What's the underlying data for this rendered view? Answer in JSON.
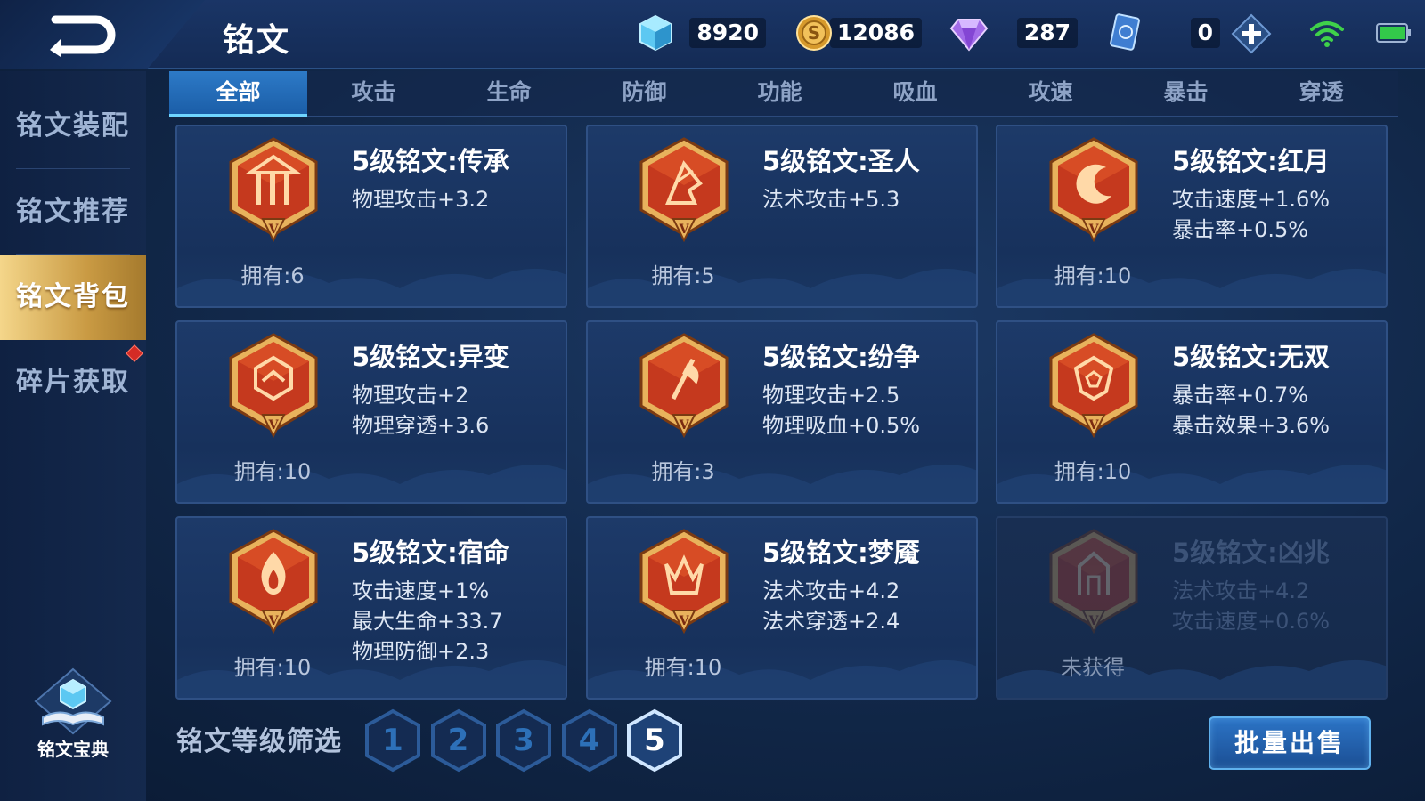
{
  "header": {
    "title": "铭文",
    "currencies": {
      "crystal": "8920",
      "coin": "12086",
      "diamond": "287",
      "card": "0"
    }
  },
  "sidebar": {
    "items": [
      {
        "label": "铭文装配"
      },
      {
        "label": "铭文推荐"
      },
      {
        "label": "铭文背包"
      },
      {
        "label": "碎片获取"
      }
    ],
    "active_index": 2,
    "codex_label": "铭文宝典"
  },
  "tabs": [
    "全部",
    "攻击",
    "生命",
    "防御",
    "功能",
    "吸血",
    "攻速",
    "暴击",
    "穿透"
  ],
  "active_tab": 0,
  "runes": [
    {
      "name": "5级铭文:传承",
      "stats": [
        "物理攻击+3.2"
      ],
      "owned": "拥有:6",
      "icon": "pillars-rune-icon",
      "locked": false
    },
    {
      "name": "5级铭文:圣人",
      "stats": [
        "法术攻击+5.3"
      ],
      "owned": "拥有:5",
      "icon": "crystal-rune-icon",
      "locked": false
    },
    {
      "name": "5级铭文:红月",
      "stats": [
        "攻击速度+1.6%",
        "暴击率+0.5%"
      ],
      "owned": "拥有:10",
      "icon": "crescent-moon-rune-icon",
      "locked": false
    },
    {
      "name": "5级铭文:异变",
      "stats": [
        "物理攻击+2",
        "物理穿透+3.6"
      ],
      "owned": "拥有:10",
      "icon": "hexagon-rune-icon",
      "locked": false
    },
    {
      "name": "5级铭文:纷争",
      "stats": [
        "物理攻击+2.5",
        "物理吸血+0.5%"
      ],
      "owned": "拥有:3",
      "icon": "axe-rune-icon",
      "locked": false
    },
    {
      "name": "5级铭文:无双",
      "stats": [
        "暴击率+0.7%",
        "暴击效果+3.6%"
      ],
      "owned": "拥有:10",
      "icon": "shield-rune-icon",
      "locked": false
    },
    {
      "name": "5级铭文:宿命",
      "stats": [
        "攻击速度+1%",
        "最大生命+33.7",
        "物理防御+2.3"
      ],
      "owned": "拥有:10",
      "icon": "flame-rune-icon",
      "locked": false
    },
    {
      "name": "5级铭文:梦魇",
      "stats": [
        "法术攻击+4.2",
        "法术穿透+2.4"
      ],
      "owned": "拥有:10",
      "icon": "crown-rune-icon",
      "locked": false
    },
    {
      "name": "5级铭文:凶兆",
      "stats": [
        "法术攻击+4.2",
        "攻击速度+0.6%"
      ],
      "owned": "未获得",
      "icon": "gate-rune-icon",
      "locked": true
    }
  ],
  "filter": {
    "label": "铭文等级筛选",
    "levels": [
      "1",
      "2",
      "3",
      "4",
      "5"
    ],
    "active_level": "5"
  },
  "sell_button": "批量出售",
  "colors": {
    "accent_gold": "#d9ac55",
    "tab_active": "#2d7ac7",
    "rune_red": "#c5391e",
    "text_white": "#ffffff"
  }
}
